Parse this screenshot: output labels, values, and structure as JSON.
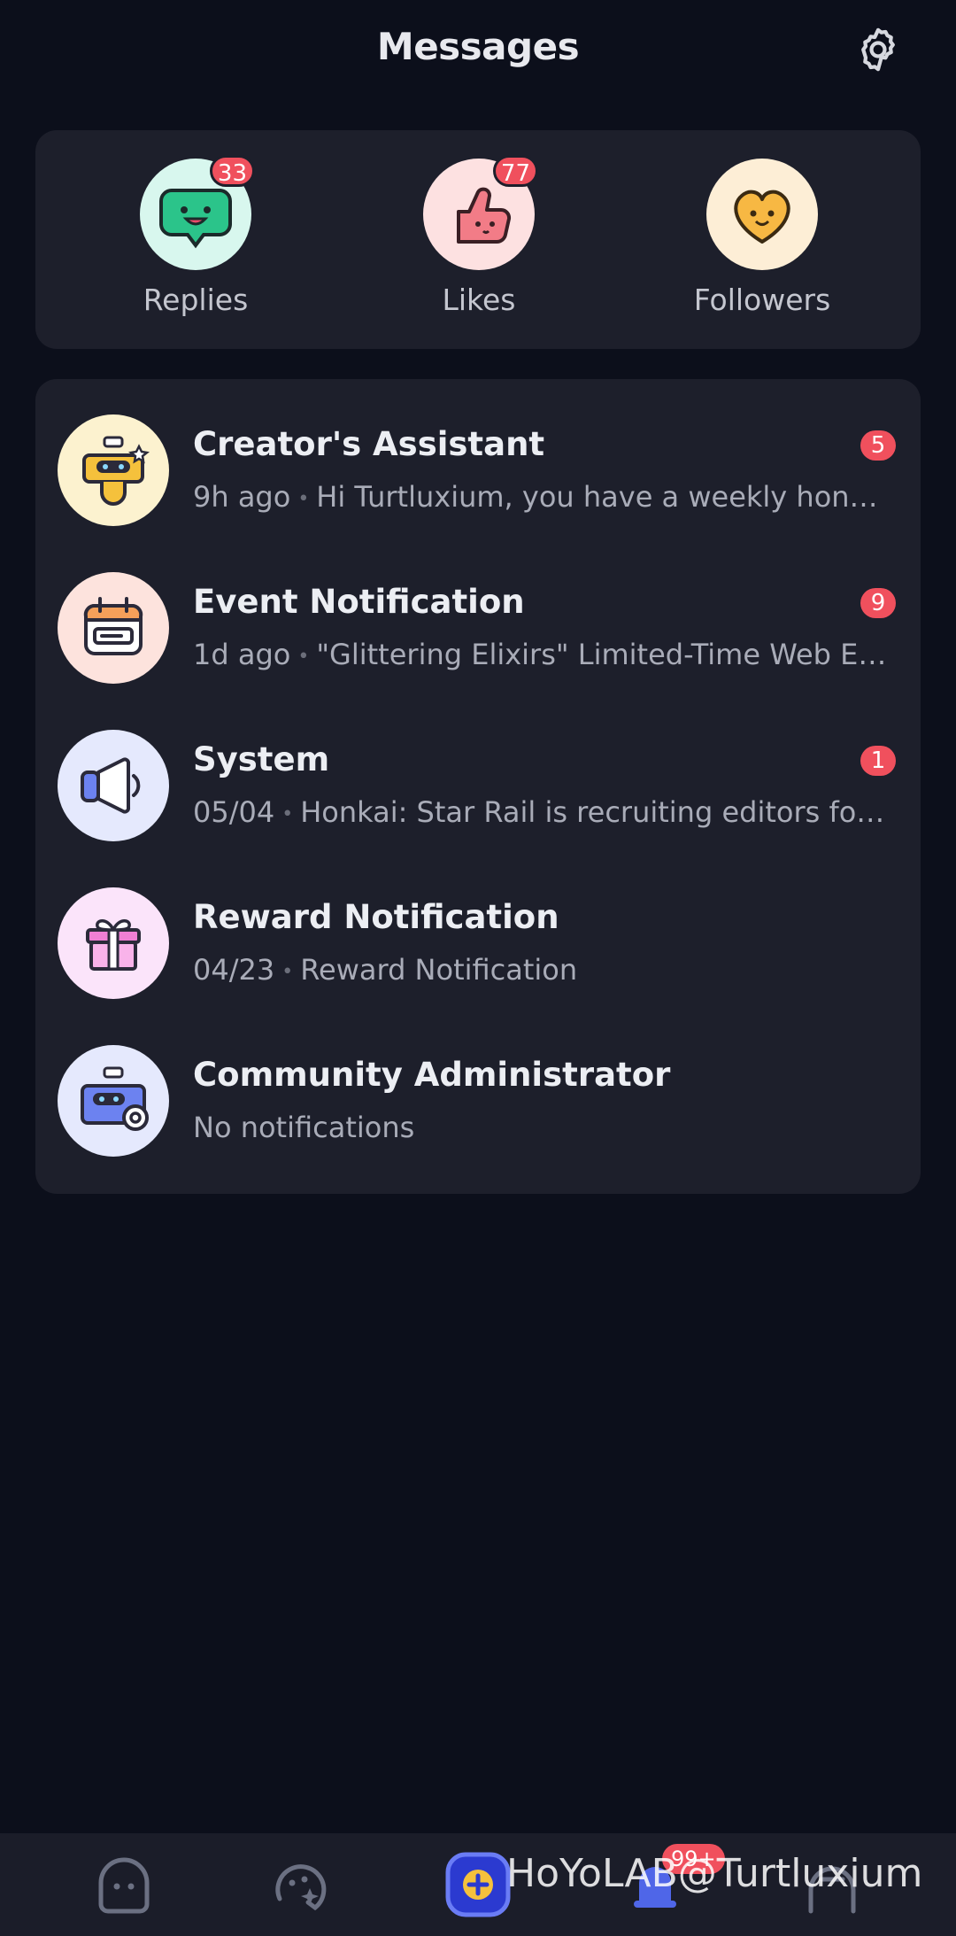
{
  "header": {
    "title": "Messages",
    "settings_icon": "gear-icon"
  },
  "quick_actions": [
    {
      "label": "Replies",
      "badge": "33",
      "icon": "smiling-chat-bubble-icon",
      "bg": "#d8f7ee"
    },
    {
      "label": "Likes",
      "badge": "77",
      "icon": "thumbs-up-icon",
      "bg": "#fde1e1"
    },
    {
      "label": "Followers",
      "badge": "",
      "icon": "heart-face-icon",
      "bg": "#fdeed6"
    }
  ],
  "notifications": [
    {
      "title": "Creator's Assistant",
      "time": "9h ago",
      "preview": "Hi Turtluxium, you have a weekly honor r...",
      "badge": "5",
      "icon": "robot-lightbulb-icon",
      "bg": "#fcf2cf"
    },
    {
      "title": "Event Notification",
      "time": "1d ago",
      "preview": "\"Glittering Elixirs\" Limited-Time Web Eve...",
      "badge": "9",
      "icon": "calendar-icon",
      "bg": "#fde3dd"
    },
    {
      "title": "System",
      "time": "05/04",
      "preview": "Honkai: Star Rail is recruiting editors for it...",
      "badge": "1",
      "icon": "megaphone-icon",
      "bg": "#e5e9fd"
    },
    {
      "title": "Reward Notification",
      "time": "04/23",
      "preview": "Reward Notification",
      "badge": "",
      "icon": "gift-icon",
      "bg": "#fbe4fa"
    },
    {
      "title": "Community Administrator",
      "time": "",
      "preview": "No notifications",
      "badge": "",
      "icon": "admin-robot-icon",
      "bg": "#e5e9fd"
    }
  ],
  "bottom_nav": {
    "items": [
      "home-icon",
      "explore-icon",
      "create-post-icon",
      "notifications-icon",
      "profile-icon"
    ],
    "notification_badge": "99+"
  },
  "watermark": "HoYoLAB@Turtluxium",
  "colors": {
    "background": "#0c0f1b",
    "card": "#1d1f2b",
    "badge": "#f0505d",
    "accent": "#4f66e8"
  }
}
